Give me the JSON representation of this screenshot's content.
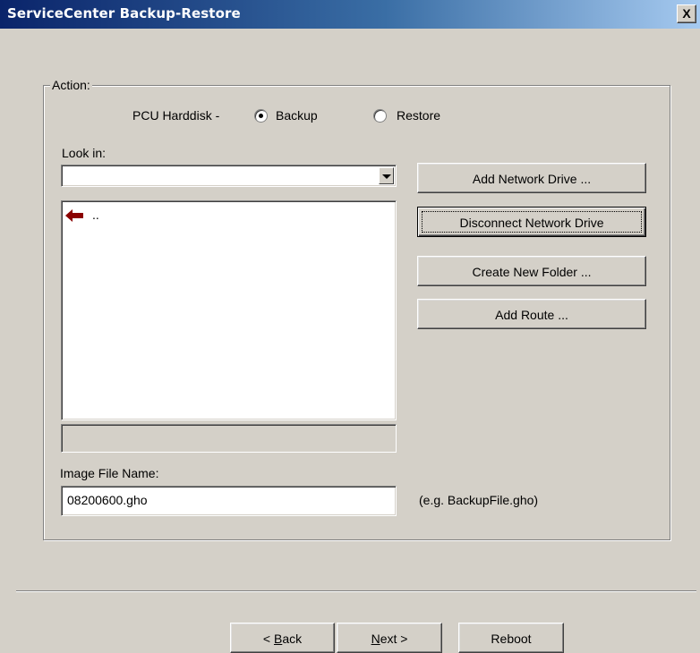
{
  "window": {
    "title": "ServiceCenter Backup-Restore",
    "close_glyph": "X"
  },
  "action": {
    "caption": "Action:",
    "source_label": "PCU Harddisk -",
    "backup_label": "Backup",
    "restore_label": "Restore",
    "selected": "Backup"
  },
  "browser": {
    "look_in_label": "Look in:",
    "look_in_value": "",
    "items": [
      {
        "icon": "back-arrow-icon",
        "label": ".."
      }
    ],
    "path_value": ""
  },
  "buttons": {
    "add_network_drive": "Add Network Drive ...",
    "disconnect_network_drive": "Disconnect Network Drive",
    "create_new_folder": "Create New Folder ...",
    "add_route": "Add Route ..."
  },
  "image_file": {
    "label": "Image File Name:",
    "value": "08200600.gho",
    "hint": "(e.g. BackupFile.gho)"
  },
  "nav": {
    "back_mnemonic": "B",
    "back_rest": "ack",
    "back_prefix": "< ",
    "next_mnemonic": "N",
    "next_rest": "ext >",
    "reboot": "Reboot"
  },
  "colors": {
    "titlebar_start": "#0a246a",
    "titlebar_end": "#a6caf0",
    "back_arrow": "#8b0000",
    "face": "#d4d0c8"
  }
}
